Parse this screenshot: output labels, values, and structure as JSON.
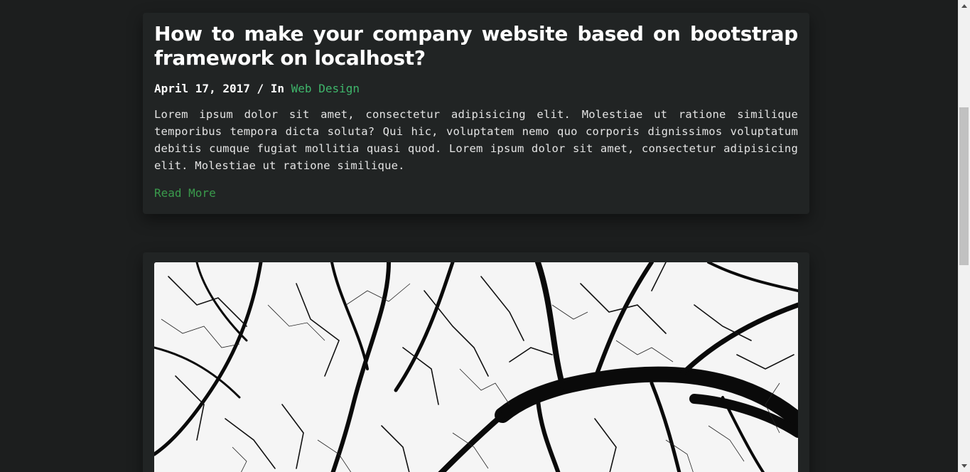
{
  "posts": [
    {
      "title": "How to make your company website based on bootstrap framework on localhost?",
      "date": "April 17, 2017",
      "meta_separator": " / In ",
      "category": "Web Design",
      "excerpt": "Lorem ipsum dolor sit amet, consectetur adipisicing elit. Molestiae ut ratione similique temporibus tempora dicta soluta? Qui hic, voluptatem nemo quo corporis dignissimos voluptatum debitis cumque fugiat mollitia quasi quod. Lorem ipsum dolor sit amet, consectetur adipisicing elit. Molestiae ut ratione similique.",
      "read_more": "Read More"
    },
    {
      "image": "bare-tree-branches-black-and-white-photo"
    }
  ],
  "colors": {
    "background": "#1c1e1e",
    "card": "#212424",
    "accent_link": "#3fb66b",
    "read_more": "#3a9b4c",
    "text": "#ffffff"
  },
  "icons": {
    "scroll_up": "arrow-up-icon",
    "scroll_down": "arrow-down-icon"
  }
}
